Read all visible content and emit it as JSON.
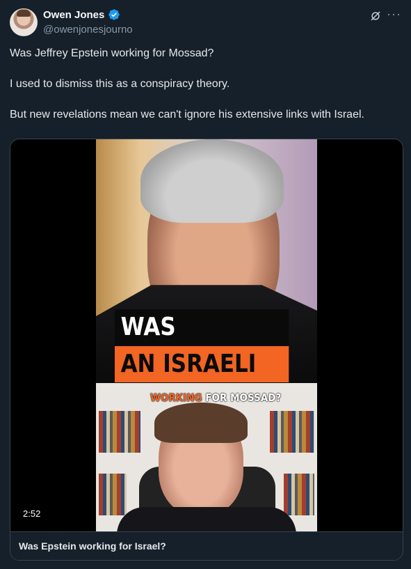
{
  "author": {
    "name": "Owen Jones",
    "handle": "@owenjonesjourno",
    "verified": true,
    "verified_color": "#1d9bf0"
  },
  "actions": {
    "grok_icon": "grok-icon",
    "more_icon": "more-icon",
    "more_label": "···"
  },
  "tweet": {
    "paragraphs": [
      "Was Jeffrey Epstein working for Mossad?",
      "I used to dismiss this as a conspiracy theory.",
      "But new revelations mean we can't ignore his extensive links with Israel."
    ]
  },
  "video": {
    "overlay_line1": "WAS EPSTEIN",
    "overlay_line2": "AN ISRAELI SPY?",
    "caption_highlight": "WORKING",
    "caption_rest": " FOR MOSSAD?",
    "duration": "2:52",
    "accent_color": "#f26522"
  },
  "card": {
    "title": "Was Epstein working for Israel?"
  },
  "colors": {
    "background": "#15202b",
    "text": "#e7e9ea",
    "secondary": "#8b98a5",
    "border": "#38444d"
  }
}
